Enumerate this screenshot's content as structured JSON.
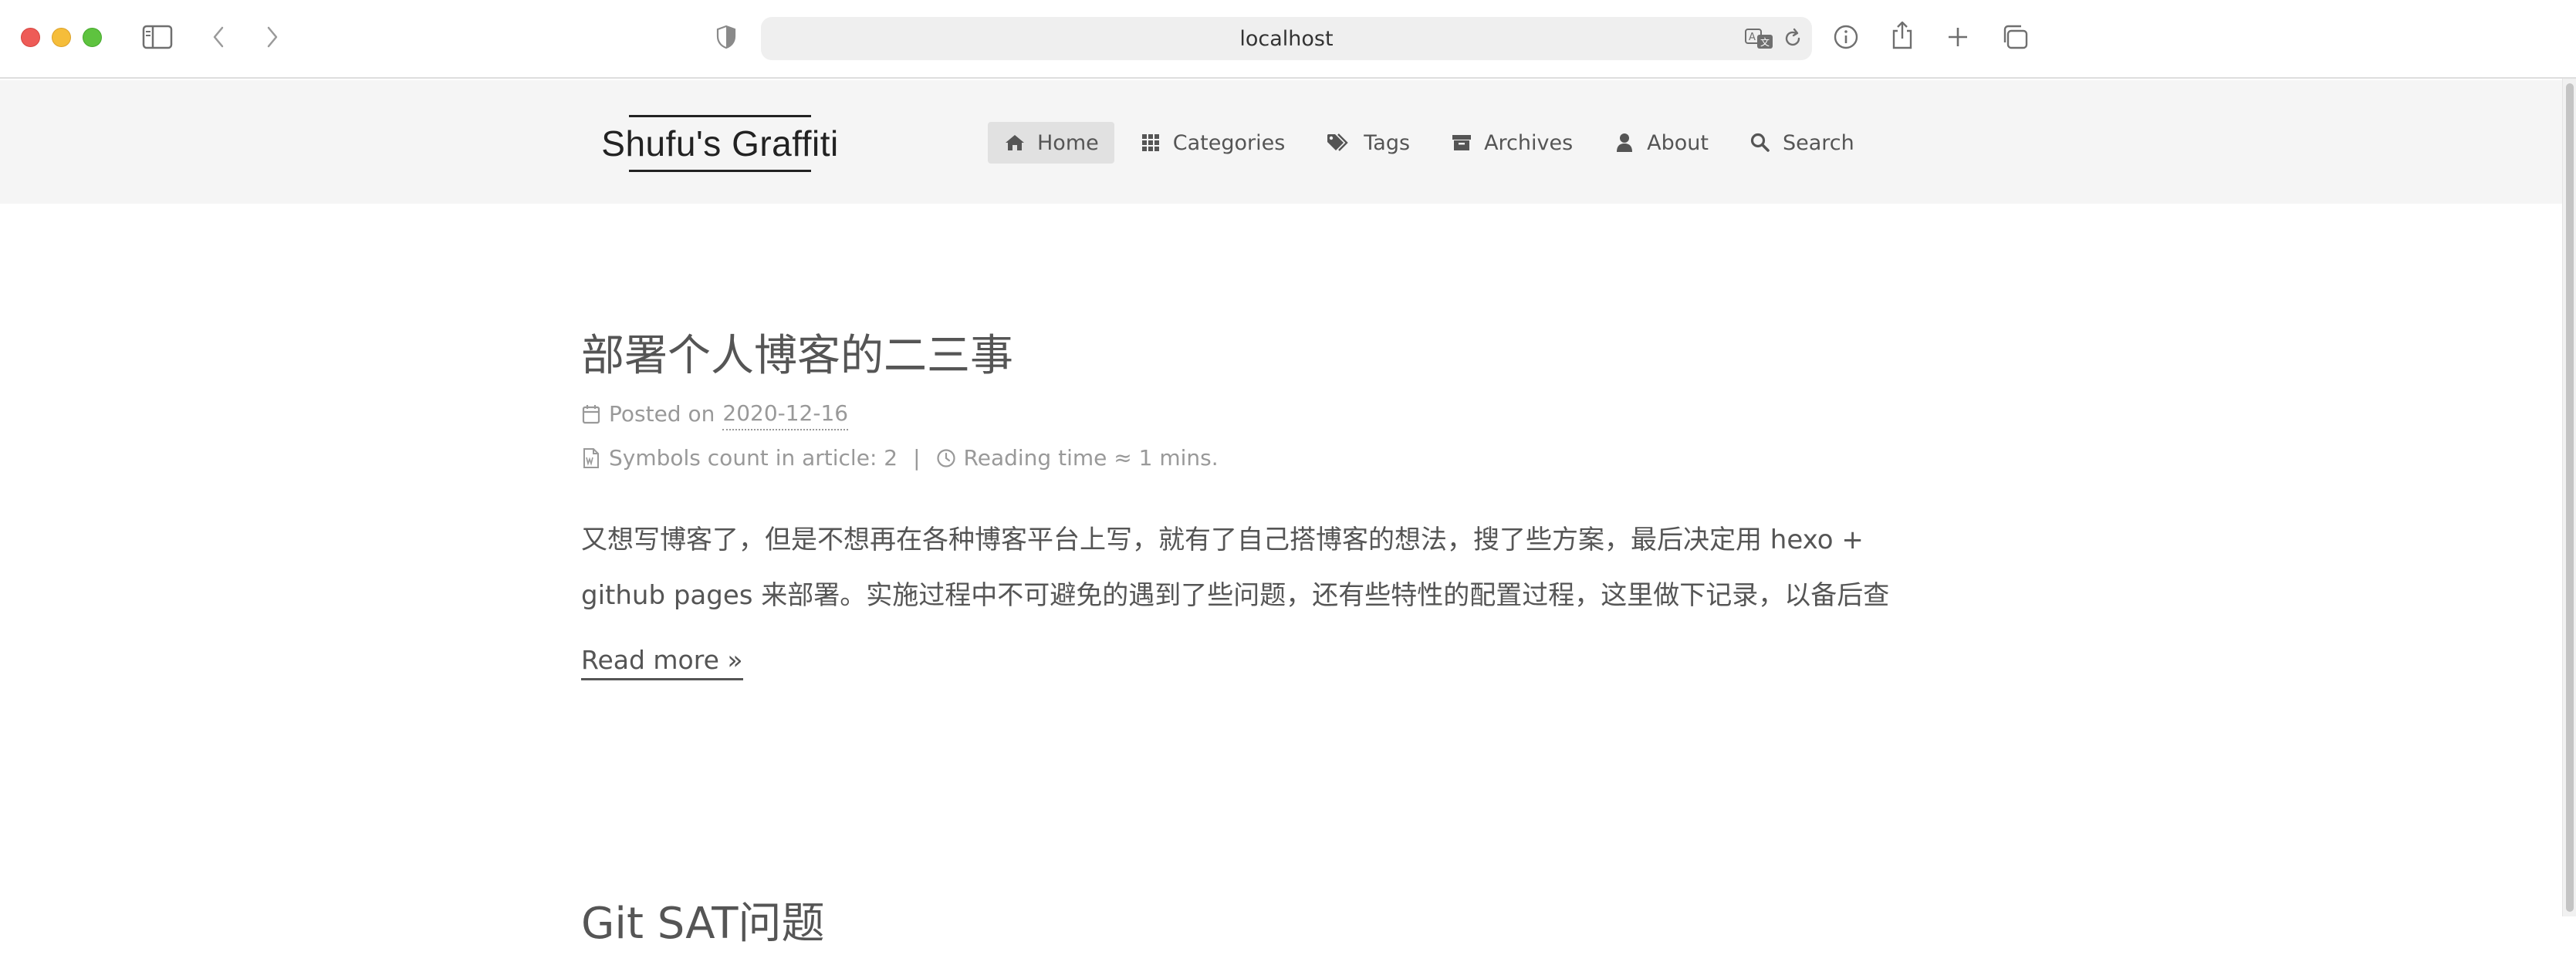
{
  "browser": {
    "url": "localhost"
  },
  "site": {
    "brand": "Shufu's Graffiti",
    "nav": [
      {
        "label": "Home",
        "icon": "home-icon",
        "active": true
      },
      {
        "label": "Categories",
        "icon": "grid-icon",
        "active": false
      },
      {
        "label": "Tags",
        "icon": "tags-icon",
        "active": false
      },
      {
        "label": "Archives",
        "icon": "archive-icon",
        "active": false
      },
      {
        "label": "About",
        "icon": "user-icon",
        "active": false
      },
      {
        "label": "Search",
        "icon": "search-icon",
        "active": false
      }
    ]
  },
  "posts": [
    {
      "title": "部署个人博客的二三事",
      "posted_label": "Posted on",
      "date": "2020-12-16",
      "symbols_label": "Symbols count in article: 2",
      "separator": "|",
      "reading_label": "Reading time ≈ 1 mins.",
      "excerpt_line1": "又想写博客了，但是不想再在各种博客平台上写，就有了自己搭博客的想法，搜了些方案，最后决定用 hexo +",
      "excerpt_line2": "github pages 来部署。实施过程中不可避免的遇到了些问题，还有些特性的配置过程，这里做下记录，以备后查",
      "read_more": "Read more »"
    },
    {
      "title": "Git SAT问题"
    }
  ],
  "colors": {
    "header_bg": "#f5f5f5",
    "active_nav_bg": "#e1e1e1",
    "text": "#555555",
    "meta": "#999999",
    "brand": "#222222"
  }
}
